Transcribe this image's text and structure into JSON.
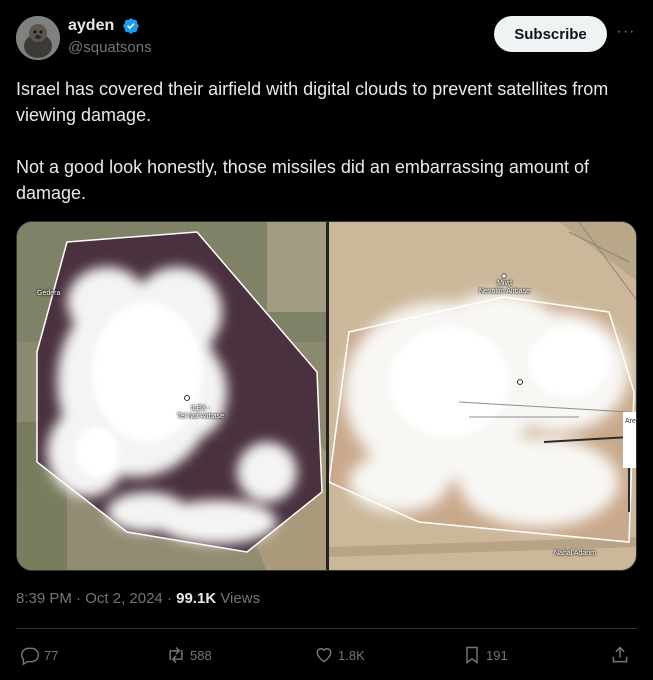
{
  "author": {
    "display_name": "ayden",
    "handle": "@squatsons",
    "verified": true,
    "avatar": "avatar-photo"
  },
  "subscribe_label": "Subscribe",
  "more_icon": "more-dots-icon",
  "tweet": {
    "paragraph_1": "Israel has covered their airfield with digital clouds to prevent satellites from viewing damage.",
    "paragraph_2": "Not a good look honestly, those missiles did an embarrassing amount of damage."
  },
  "media": {
    "left_map": {
      "airbase_label_1": "ILEX -",
      "airbase_label_2": "Tel Nof Airbase",
      "town_label": "Gedera"
    },
    "right_map": {
      "airbase_label_1": "Mivd",
      "airbase_label_2": "Nevatim Airbase",
      "area_label": "Are",
      "road_label": "Nahal Adarim"
    }
  },
  "meta": {
    "time": "8:39 PM",
    "date": "Oct 2, 2024",
    "views_count": "99.1K",
    "views_label": "Views"
  },
  "actions": {
    "replies": "77",
    "reposts": "588",
    "likes": "1.8K",
    "bookmarks": "191"
  },
  "colors": {
    "background": "#000000",
    "text": "#e7e9ea",
    "muted": "#71767b",
    "verified": "#1d9bf0",
    "button_bg": "#eff3f4"
  }
}
